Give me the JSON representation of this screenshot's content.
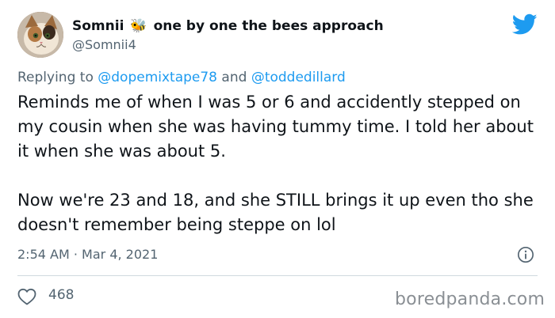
{
  "tweet": {
    "display_name": "Somnii",
    "name_emoji": "🐝",
    "name_suffix": "one by one the bees approach",
    "handle": "@Somnii4",
    "reply_prefix": "Replying to",
    "reply_mention_1": "@dopemixtape78",
    "reply_and": "and",
    "reply_mention_2": "@toddedillard",
    "paragraph_1": "Reminds me of when I was 5 or 6 and accidently stepped on my cousin when she was having tummy time. I told her about it when she was about 5.",
    "paragraph_2": "Now we're 23 and 18, and she STILL brings it up even tho she doesn't remember being steppe on lol",
    "time": "2:54 AM",
    "separator": "·",
    "date": "Mar 4, 2021",
    "like_count": "468"
  },
  "watermark": "boredpanda.com",
  "colors": {
    "twitter_blue": "#1d9bf0",
    "muted_text": "#536471",
    "main_text": "#0f1419",
    "divider": "#cfd9de"
  },
  "icons": {
    "brand": "twitter-bird-icon",
    "info": "info-icon",
    "like": "heart-icon"
  }
}
